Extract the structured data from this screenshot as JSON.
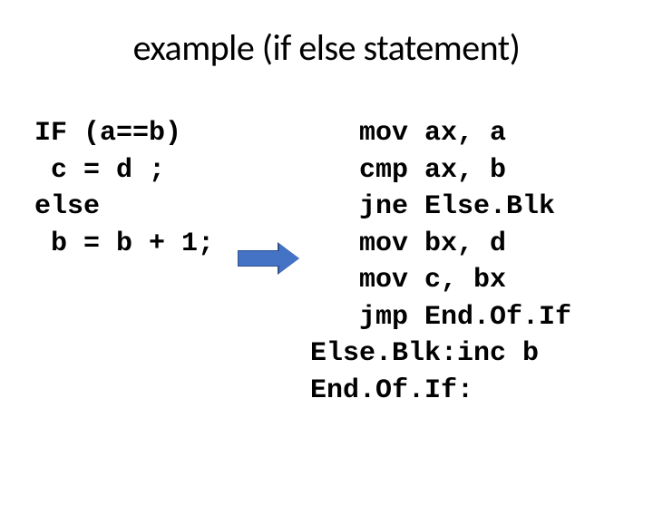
{
  "title": "example (if else statement)",
  "left_code": "IF (a==b)\n c = d ;\nelse\n b = b + 1;",
  "right_code": "   mov ax, a\n   cmp ax, b\n   jne Else.Blk\n   mov bx, d\n   mov c, bx\n   jmp End.Of.If\nElse.Blk:inc b\nEnd.Of.If:"
}
